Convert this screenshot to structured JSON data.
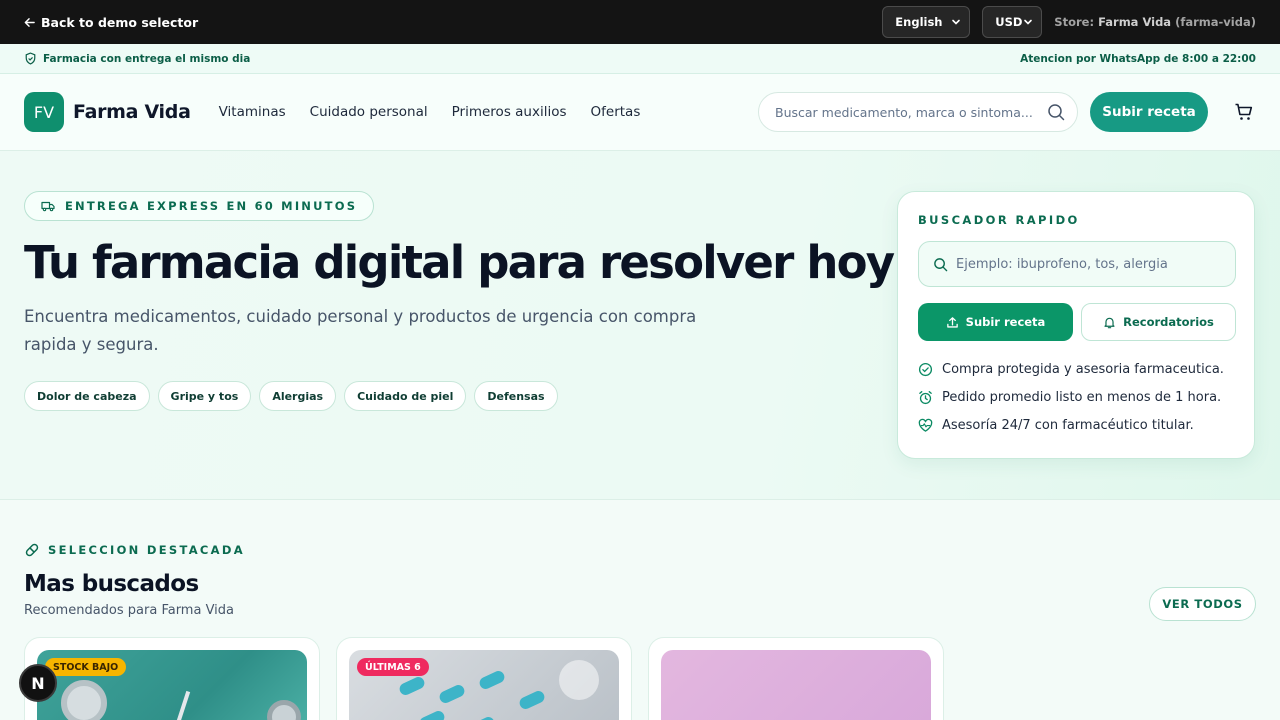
{
  "topbar": {
    "back_label": "Back to demo selector",
    "language": "English",
    "currency": "USD",
    "store_prefix": "Store:",
    "store_name": "Farma Vida",
    "store_slug": "(farma-vida)"
  },
  "infostrip": {
    "left_text": "Farmacia con entrega el mismo dia",
    "right_text": "Atencion por WhatsApp de 8:00 a 22:00"
  },
  "header": {
    "logo_initials": "FV",
    "brand": "Farma Vida",
    "nav": [
      "Vitaminas",
      "Cuidado personal",
      "Primeros auxilios",
      "Ofertas"
    ],
    "search_placeholder": "Buscar medicamento, marca o sintoma...",
    "cta_label": "Subir receta"
  },
  "hero": {
    "badge": "ENTREGA EXPRESS EN 60 MINUTOS",
    "title": "Tu farmacia digital para resolver hoy",
    "subtitle": "Encuentra medicamentos, cuidado personal y productos de urgencia con compra rapida y segura.",
    "chips": [
      "Dolor de cabeza",
      "Gripe y tos",
      "Alergias",
      "Cuidado de piel",
      "Defensas"
    ]
  },
  "quick_search": {
    "title": "BUSCADOR RAPIDO",
    "placeholder": "Ejemplo: ibuprofeno, tos, alergia",
    "primary_button": "Subir receta",
    "secondary_button": "Recordatorios",
    "features": [
      "Compra protegida y asesoria farmaceutica.",
      "Pedido promedio listo en menos de 1 hora.",
      "Asesoría 24/7 con farmacéutico titular."
    ]
  },
  "featured": {
    "label": "SELECCION DESTACADA",
    "title": "Mas buscados",
    "subtitle": "Recomendados para Farma Vida",
    "see_all": "VER TODOS",
    "tags": [
      "STOCK BAJO",
      "ÚLTIMAS 6"
    ]
  },
  "dev_badge": "N",
  "colors": {
    "brand": "#0f8f6e",
    "accent": "#179a84",
    "primary_button": "#0b9668",
    "tag_low_stock": "#f7b500",
    "tag_last_units": "#ef2a5f"
  }
}
